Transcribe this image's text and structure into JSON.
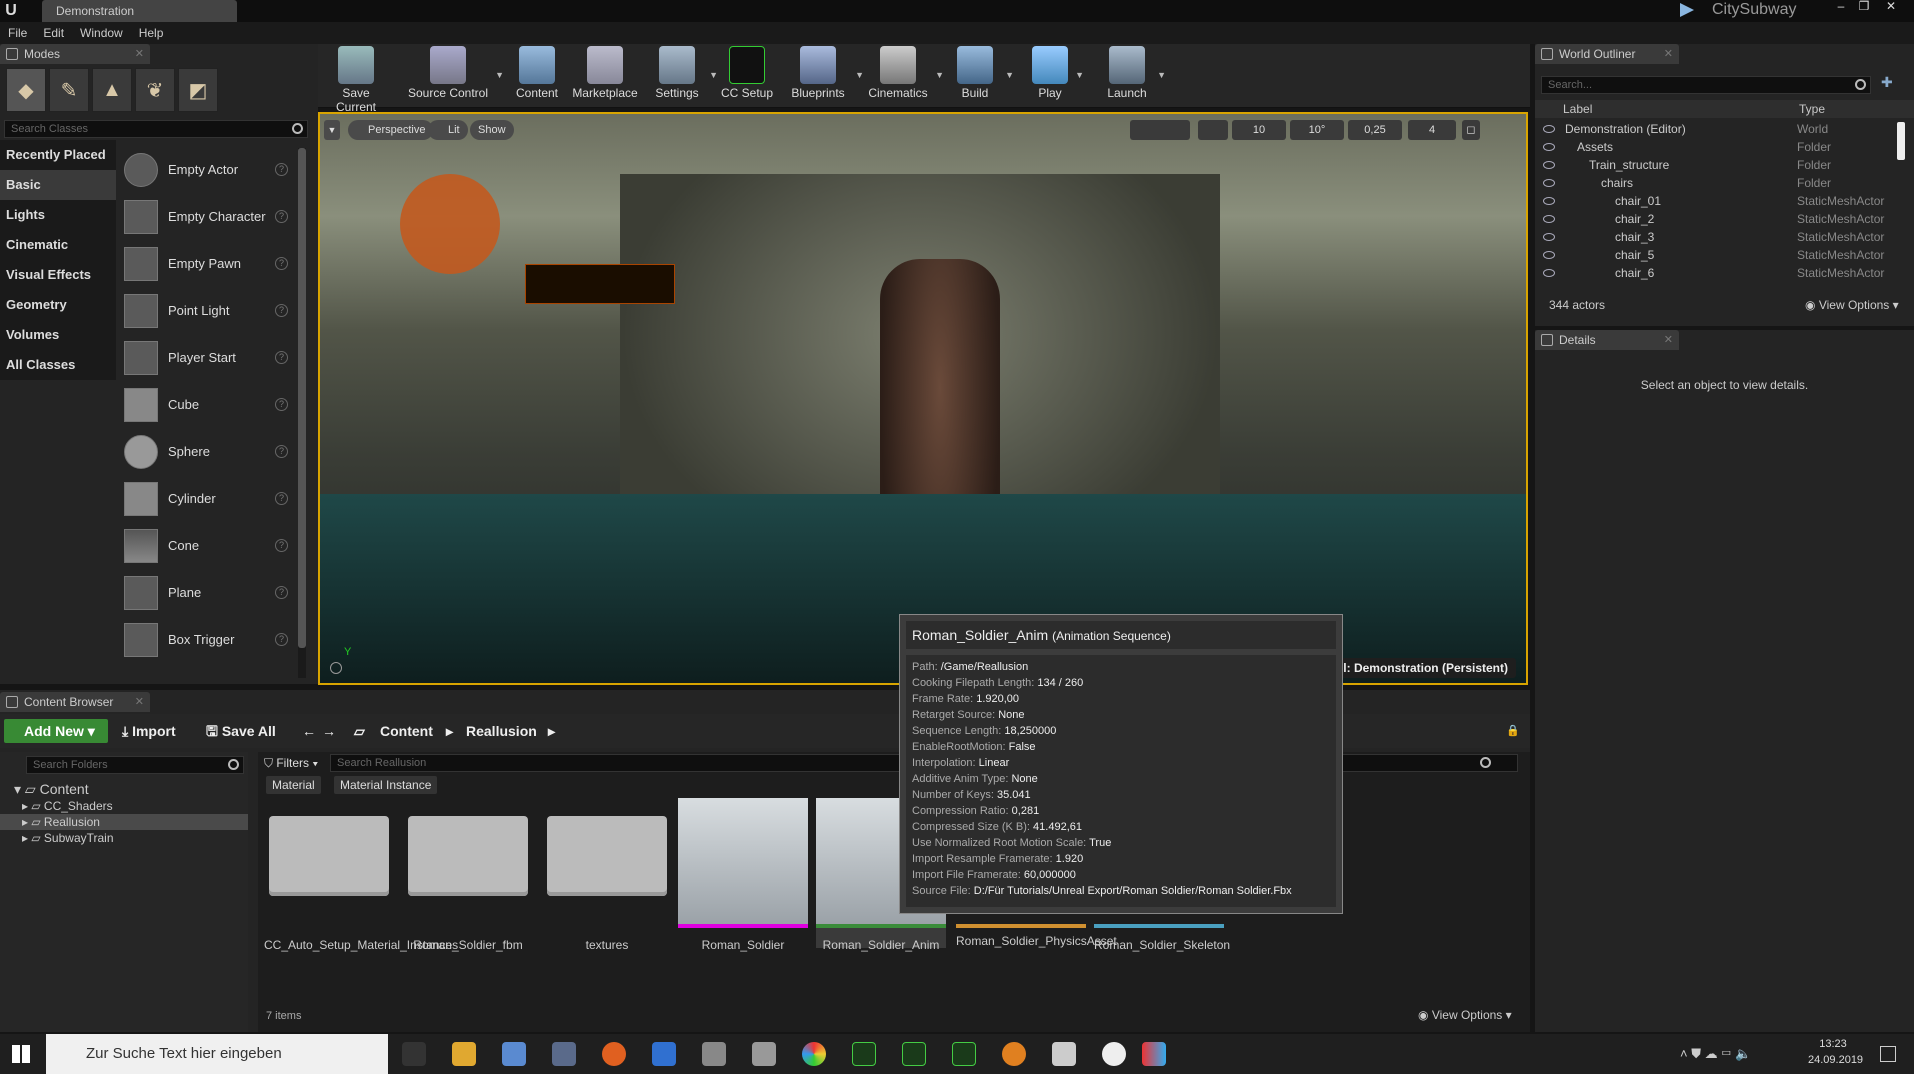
{
  "window": {
    "doc_tab": "Demonstration",
    "project": "CitySubway",
    "min": "–",
    "max": "❐",
    "close": "✕"
  },
  "menu": [
    "File",
    "Edit",
    "Window",
    "Help"
  ],
  "modes": {
    "tab": "Modes",
    "search_placeholder": "Search Classes",
    "categories": [
      "Recently Placed",
      "Basic",
      "Lights",
      "Cinematic",
      "Visual Effects",
      "Geometry",
      "Volumes",
      "All Classes"
    ],
    "items": [
      "Empty Actor",
      "Empty Character",
      "Empty Pawn",
      "Point Light",
      "Player Start",
      "Cube",
      "Sphere",
      "Cylinder",
      "Cone",
      "Plane",
      "Box Trigger"
    ]
  },
  "toolbar": {
    "buttons": [
      "Save Current",
      "Source Control",
      "Content",
      "Marketplace",
      "Settings",
      "CC Setup",
      "Blueprints",
      "Cinematics",
      "Build",
      "Play",
      "Launch"
    ]
  },
  "viewport": {
    "perspective": "Perspective",
    "lit": "Lit",
    "show": "Show",
    "grid_snap": "10",
    "rot_snap": "10°",
    "scale_snap": "0,25",
    "cam_speed": "4",
    "level_label": "vel:  Demonstration (Persistent)",
    "axis_y": "Y"
  },
  "tooltip": {
    "name": "Roman_Soldier_Anim",
    "kind": "(Animation Sequence)",
    "rows": [
      {
        "k": "Path:",
        "v": "/Game/Reallusion"
      },
      {
        "k": "Cooking Filepath Length:",
        "v": "134 / 260"
      },
      {
        "k": "Frame Rate:",
        "v": "1.920,00"
      },
      {
        "k": "Retarget Source:",
        "v": "None"
      },
      {
        "k": "Sequence Length:",
        "v": "18,250000"
      },
      {
        "k": "EnableRootMotion:",
        "v": "False"
      },
      {
        "k": "Interpolation:",
        "v": "Linear"
      },
      {
        "k": "Additive Anim Type:",
        "v": "None"
      },
      {
        "k": "Number of Keys:",
        "v": "35.041"
      },
      {
        "k": "Compression Ratio:",
        "v": "0,281"
      },
      {
        "k": "Compressed Size (K B):",
        "v": "41.492,61"
      },
      {
        "k": "Use Normalized Root Motion Scale:",
        "v": "True"
      },
      {
        "k": "Import Resample Framerate:",
        "v": "1.920"
      },
      {
        "k": "Import File Framerate:",
        "v": "60,000000"
      },
      {
        "k": "Source File:",
        "v": "D:/Für Tutorials/Unreal Export/Roman Soldier/Roman Soldier.Fbx"
      }
    ]
  },
  "content_browser": {
    "tab": "Content Browser",
    "add_new": "Add New",
    "import": "Import",
    "save_all": "Save All",
    "crumb_root": "Content",
    "crumb_sub": "Reallusion",
    "search_folders": "Search Folders",
    "filters": "Filters",
    "search_assets": "Search Reallusion",
    "filter_chips": [
      "Material",
      "Material Instance"
    ],
    "tree": [
      "Content",
      "CC_Shaders",
      "Reallusion",
      "SubwayTrain"
    ],
    "assets": [
      "CC_Auto_Setup_Material_Instances",
      "Roman_Soldier_fbm",
      "textures",
      "Roman_Soldier",
      "Roman_Soldier_Anim",
      "Roman_Soldier_PhysicsAsset",
      "Roman_Soldier_Skeleton"
    ],
    "item_count": "7 items",
    "view_options": "View Options"
  },
  "outliner": {
    "tab": "World Outliner",
    "search_placeholder": "Search...",
    "col_label": "Label",
    "col_type": "Type",
    "rows": [
      {
        "label": "Demonstration (Editor)",
        "type": "World",
        "indent": 0
      },
      {
        "label": "Assets",
        "type": "Folder",
        "indent": 1
      },
      {
        "label": "Train_structure",
        "type": "Folder",
        "indent": 2
      },
      {
        "label": "chairs",
        "type": "Folder",
        "indent": 3
      },
      {
        "label": "chair_01",
        "type": "StaticMeshActor",
        "indent": 4
      },
      {
        "label": "chair_2",
        "type": "StaticMeshActor",
        "indent": 4
      },
      {
        "label": "chair_3",
        "type": "StaticMeshActor",
        "indent": 4
      },
      {
        "label": "chair_5",
        "type": "StaticMeshActor",
        "indent": 4
      },
      {
        "label": "chair_6",
        "type": "StaticMeshActor",
        "indent": 4
      }
    ],
    "actor_count": "344 actors",
    "view_options": "View Options"
  },
  "details": {
    "tab": "Details",
    "empty_msg": "Select an object to view details."
  },
  "taskbar": {
    "search": "Zur Suche Text hier eingeben",
    "time": "13:23",
    "date": "24.09.2019"
  }
}
